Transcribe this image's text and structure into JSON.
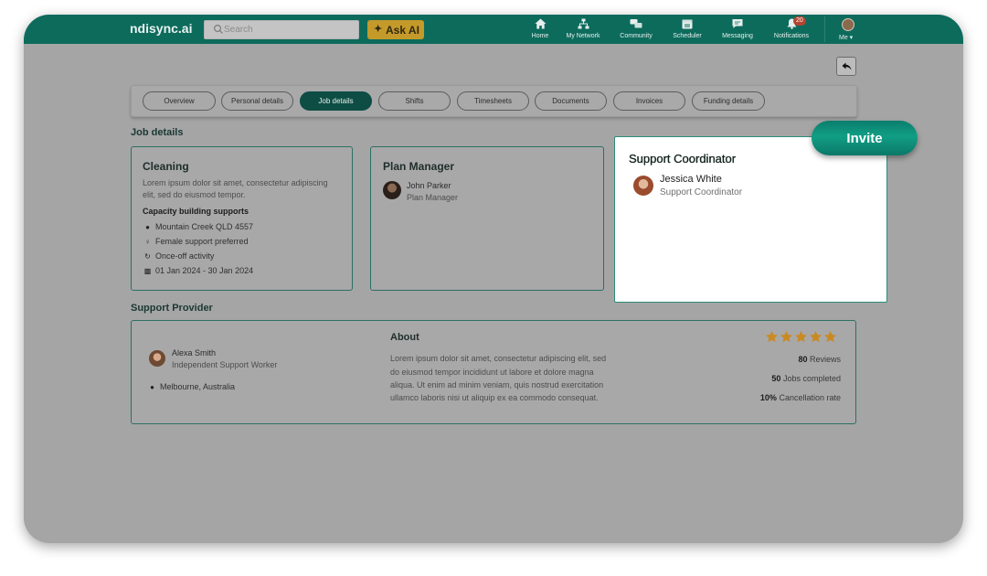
{
  "header": {
    "brand": "ndisync.ai",
    "search_placeholder": "Search",
    "ask_ai": "Ask AI",
    "nav": [
      {
        "label": "Home",
        "icon": "home-icon"
      },
      {
        "label": "My Network",
        "icon": "network-icon"
      },
      {
        "label": "Community",
        "icon": "community-icon"
      },
      {
        "label": "Scheduler",
        "icon": "calendar-icon"
      },
      {
        "label": "Messaging",
        "icon": "message-icon"
      },
      {
        "label": "Notifications",
        "icon": "bell-icon",
        "badge": "20"
      }
    ],
    "me_label": "Me ▾"
  },
  "tabs": [
    {
      "label": "Overview",
      "active": false
    },
    {
      "label": "Personal details",
      "active": false
    },
    {
      "label": "Job details",
      "active": true
    },
    {
      "label": "Shifts",
      "active": false
    },
    {
      "label": "Timesheets",
      "active": false
    },
    {
      "label": "Documents",
      "active": false
    },
    {
      "label": "Invoices",
      "active": false
    },
    {
      "label": "Funding details",
      "active": false
    }
  ],
  "job_details": {
    "section_title": "Job details",
    "cleaning": {
      "title": "Cleaning",
      "description_line1": "Lorem ipsum dolor sit amet, consectetur adipiscing",
      "description_line2": "elit, sed do eiusmod tempor.",
      "category": "Capacity building supports",
      "location": "Mountain Creek QLD 4557",
      "preference": "Female support preferred",
      "frequency": "Once-off activity",
      "dates": "01 Jan 2024  -  30 Jan 2024"
    },
    "plan_manager": {
      "title": "Plan Manager",
      "name": "John Parker",
      "role": "Plan Manager"
    },
    "support_coordinator": {
      "title": "Support Coordinator",
      "name": "Jessica White",
      "role": "Support Coordinator",
      "invite_label": "Invite"
    }
  },
  "support_provider": {
    "section_title": "Support Provider",
    "name": "Alexa Smith",
    "role": "Independent Support Worker",
    "location": "Melbourne, Australia",
    "about_title": "About",
    "about_lines": [
      "Lorem ipsum dolor sit amet, consectetur adipiscing elit, sed",
      "do eiusmod tempor incididunt ut labore et dolore magna",
      "aliqua. Ut enim ad minim veniam, quis nostrud exercitation",
      "ullamco laboris nisi ut aliquip ex ea commodo consequat."
    ],
    "rating": 5,
    "reviews_count": "80",
    "reviews_label": "Reviews",
    "jobs_count": "50",
    "jobs_label": "Jobs completed",
    "cancellation_rate": "10%",
    "cancellation_label": "Cancellation rate"
  },
  "colors": {
    "brand": "#0d6b5c",
    "active_tab": "#0d4d44",
    "star": "#c98a22",
    "badge": "#b5432f"
  }
}
